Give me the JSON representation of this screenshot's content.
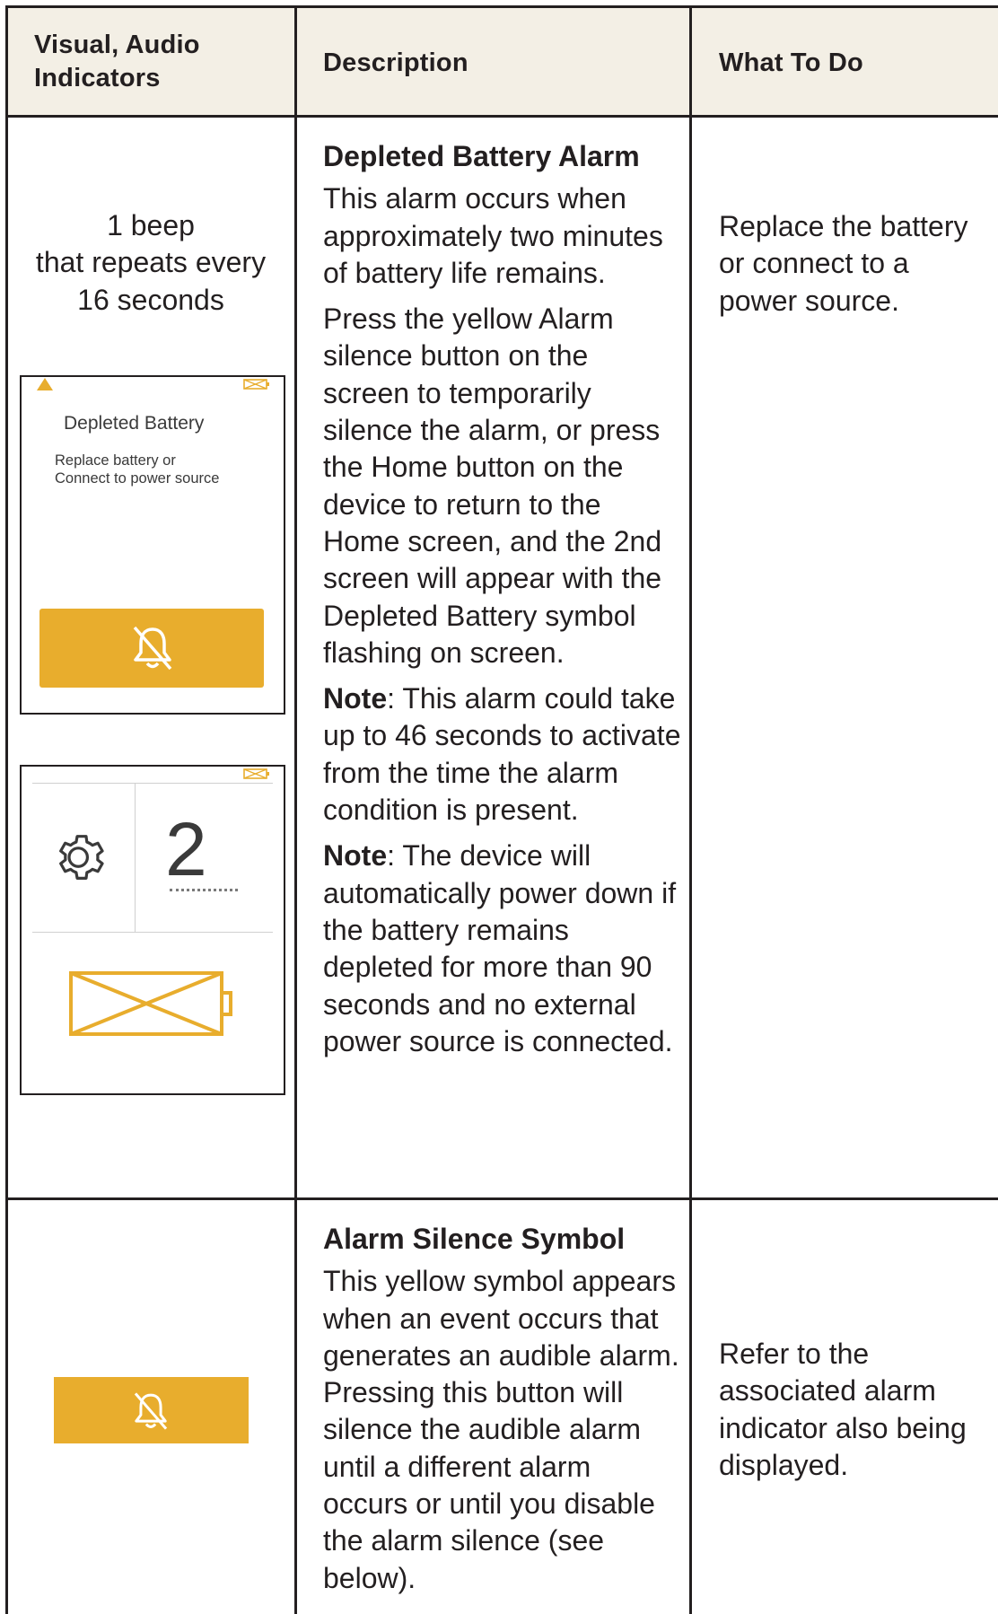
{
  "header": {
    "col1": "Visual, Audio\nIndicators",
    "col2": "Description",
    "col3": "What To Do"
  },
  "rows": [
    {
      "audio": "1 beep\nthat repeats every\n16 seconds",
      "screen1": {
        "title": "Depleted Battery",
        "subtitle": "Replace battery or\nConnect to power source"
      },
      "screen2": {
        "number": "2"
      },
      "title": "Depleted Battery Alarm",
      "p1": "This alarm occurs when approximately two minutes of battery life remains.",
      "p2": "Press the yellow Alarm silence button on the screen to temporarily silence the alarm, or press the Home button on the device to return to the Home screen, and the 2nd screen will appear with the Depleted Battery symbol flashing on screen.",
      "note1_label": "Note",
      "note1_text": ": This alarm could take up to 46 seconds to activate from the time the alarm condition is present.",
      "note2_label": "Note",
      "note2_text": ": The device will automatically power down if the battery remains depleted for more than 90 seconds and no external power source is connected.",
      "action": "Replace the battery or connect to a power source."
    },
    {
      "title": "Alarm Silence Symbol",
      "p1": "This yellow symbol appears when an event occurs that generates an audible alarm. Pressing this button will silence the audible alarm until a different alarm occurs or until you disable the alarm silence (see below).",
      "action": "Refer to the associated alarm indicator also being displayed."
    }
  ],
  "colors": {
    "header_bg": "#f3efe5",
    "accent_yellow": "#e8ad2d",
    "border": "#231f20"
  },
  "icons": [
    "bell-slash-icon",
    "warning-triangle-icon",
    "battery-empty-icon",
    "gear-icon"
  ]
}
